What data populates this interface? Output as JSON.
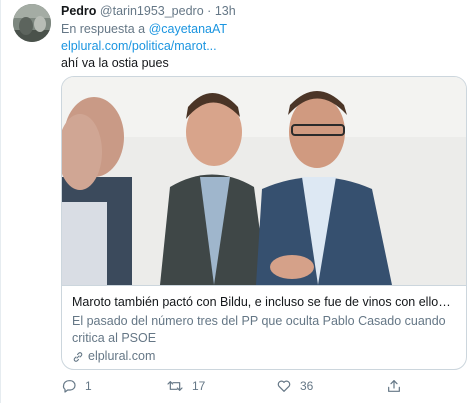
{
  "author": {
    "name": "Pedro",
    "handle": "@tarin1953_pedro",
    "separator": "·",
    "time": "13h"
  },
  "reply": {
    "prefix": "En respuesta a",
    "target": "@cayetanaAT"
  },
  "tweet": {
    "link": "elplural.com/politica/marot...",
    "text": "ahí va la ostia pues"
  },
  "card": {
    "title": "Maroto también pactó con Bildu, e incluso se fue de vinos con ellos - El ...",
    "description": "El pasado del número tres del PP que oculta Pablo Casado cuando critica al PSOE",
    "domain": "elplural.com"
  },
  "actions": {
    "replies": "1",
    "retweets": "17",
    "likes": "36"
  },
  "colors": {
    "link": "#1b95e0",
    "muted": "#657786",
    "border": "#ccd6dd"
  },
  "icons": [
    "reply-icon",
    "retweet-icon",
    "like-icon",
    "share-icon",
    "link-icon"
  ]
}
